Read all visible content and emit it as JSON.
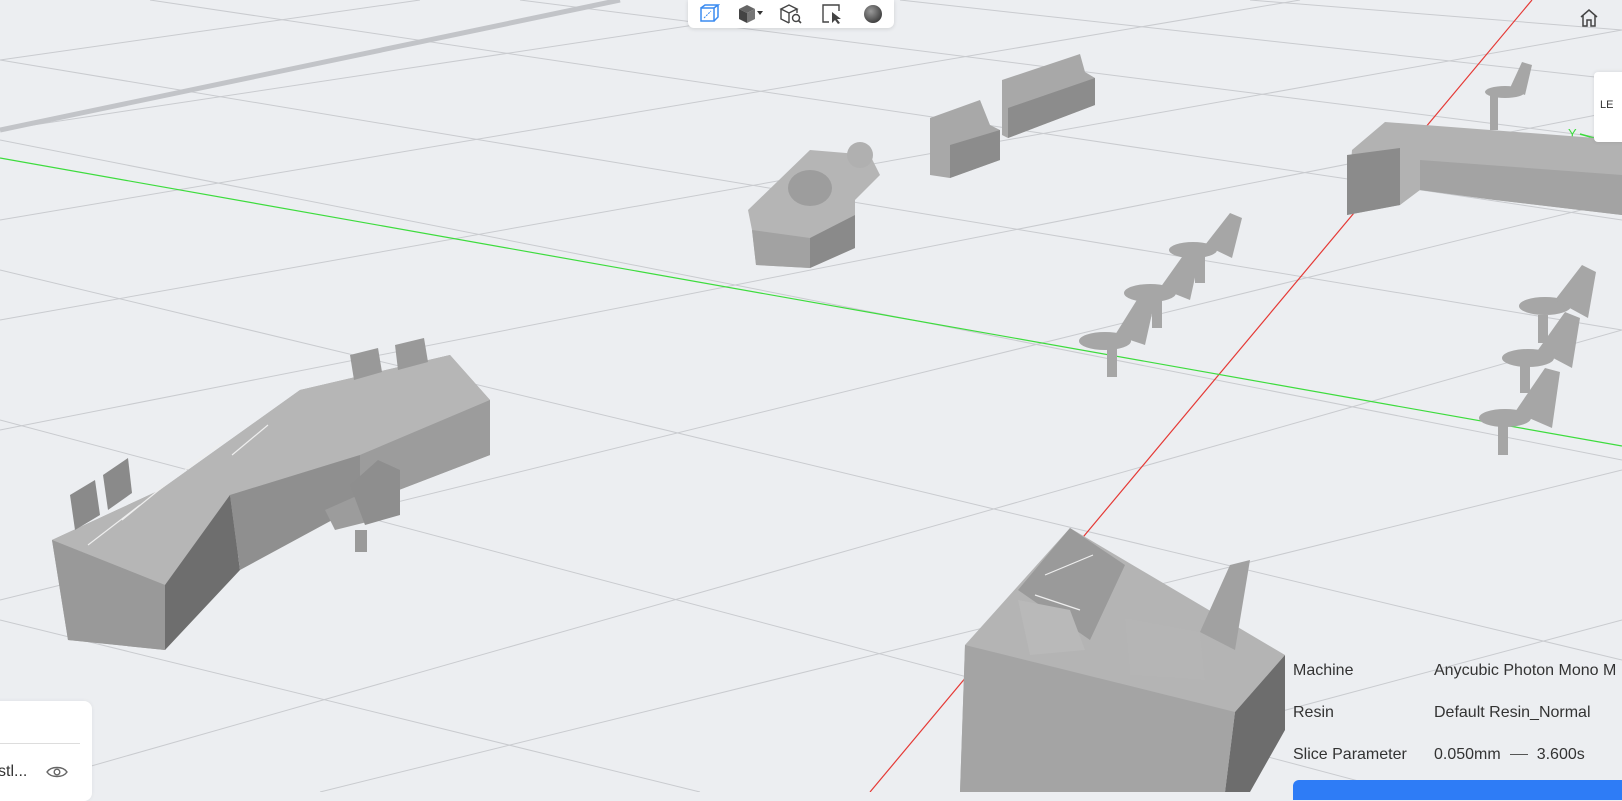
{
  "toolbar": {
    "items": [
      {
        "icon": "perspective-cube-icon"
      },
      {
        "icon": "cube-dropdown-icon"
      },
      {
        "icon": "cube-search-icon"
      },
      {
        "icon": "select-cursor-icon"
      },
      {
        "icon": "sphere-icon"
      }
    ]
  },
  "home": {
    "icon": "home-icon"
  },
  "view_cube": {
    "label": "LE"
  },
  "axes": {
    "y_label": "Y",
    "x_color": "#e53935",
    "y_color": "#3ddc3d"
  },
  "machine_info": {
    "machine_label": "Machine",
    "machine_value": "Anycubic Photon Mono M",
    "resin_label": "Resin",
    "resin_value": "Default Resin_Normal",
    "slice_label": "Slice Parameter",
    "layer_height": "0.050mm",
    "exposure": "3.600s"
  },
  "file_panel": {
    "file_name": "stl..."
  },
  "colors": {
    "accent": "#2e7cf6",
    "background": "#eceef1",
    "model": "#a9a9a9"
  }
}
